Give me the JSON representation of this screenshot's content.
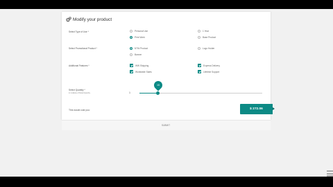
{
  "form": {
    "title": "Modify your product",
    "type_of_use": {
      "label": "Select Type of Use *",
      "options": [
        "Personal Use",
        "1 Year",
        "Print Work",
        "Base Product"
      ],
      "selected": "Print Work"
    },
    "promotional_product": {
      "label": "Select Promotional Product *",
      "options": [
        "NTW Product",
        "Logo Holder",
        "Banner"
      ],
      "selected": "NTW Product"
    },
    "additional_features": {
      "label": "Additional Features *",
      "options": [
        "WW Shipping",
        "Express Delivery",
        "Worldwide Sales",
        "Lifetime Support"
      ],
      "checked": [
        "WW Shipping",
        "Express Delivery",
        "Worldwide Sales",
        "Lifetime Support"
      ]
    },
    "quantity": {
      "label": "Select Quantity *",
      "sublabel": "in multiples of Retail Quantity",
      "min": "1",
      "value": 15,
      "max": 100,
      "bubble": "15"
    },
    "cost": {
      "label": "This would cost you:",
      "amount": "$ 272.06"
    },
    "submit_label": "SUBMIT"
  },
  "colors": {
    "accent": "#0c8a85",
    "page_bg": "#f1f1f1",
    "frame_bg": "#000000"
  },
  "icons": {
    "title_icon": "cogs-icon",
    "corner_icon": "list-icon"
  }
}
